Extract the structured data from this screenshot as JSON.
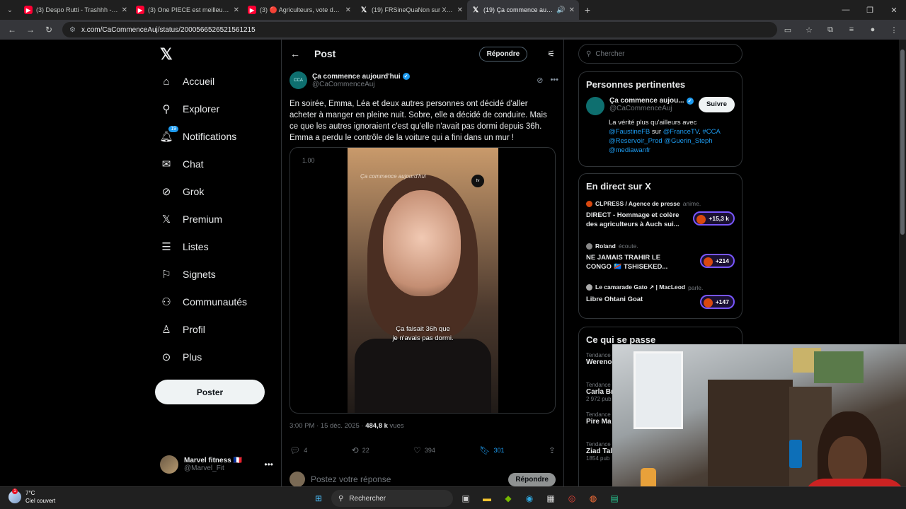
{
  "browser": {
    "tabs": [
      {
        "title": "(3) Despo Rutti - Trashhh - YouTube",
        "favicon": "youtube-icon"
      },
      {
        "title": "(3) One PIECE est meilleur sans",
        "favicon": "youtube-icon"
      },
      {
        "title": "(3) 🔴 Agriculteurs, vote du budget",
        "favicon": "youtube-icon"
      },
      {
        "title": "(19) FRSineQuaNon sur X : \"@T",
        "favicon": "x-icon"
      },
      {
        "title": "(19) Ça commence aujourd'",
        "favicon": "x-icon",
        "active": true
      }
    ],
    "url": "x.com/CaCommenceAuj/status/2000566526521561215"
  },
  "nav": {
    "items": [
      {
        "label": "Accueil",
        "icon": "home-icon"
      },
      {
        "label": "Explorer",
        "icon": "search-icon"
      },
      {
        "label": "Notifications",
        "icon": "bell-icon",
        "badge": "19"
      },
      {
        "label": "Chat",
        "icon": "mail-icon"
      },
      {
        "label": "Grok",
        "icon": "grok-icon"
      },
      {
        "label": "Premium",
        "icon": "x-logo-icon"
      },
      {
        "label": "Listes",
        "icon": "list-icon"
      },
      {
        "label": "Signets",
        "icon": "bookmark-icon"
      },
      {
        "label": "Communautés",
        "icon": "communities-icon"
      },
      {
        "label": "Profil",
        "icon": "person-icon"
      },
      {
        "label": "Plus",
        "icon": "more-circle-icon"
      }
    ],
    "post_button": "Poster",
    "account": {
      "name": "Marvel fitness 🇫🇷",
      "handle": "@Marvel_Fit"
    }
  },
  "main": {
    "header_title": "Post",
    "reply_chip": "Répondre",
    "tweet": {
      "author": "Ça commence aujourd'hui",
      "handle": "@CaCommenceAuj",
      "text": "En soirée, Emma, Léa et deux autres personnes ont décidé d'aller acheter à manger en pleine nuit. Sobre, elle a décidé de conduire. Mais ce que les autres ignoraient c'est qu'elle n'avait pas dormi depuis 36h. Emma a perdu le contrôle de la voiture qui a fini dans un mur !",
      "video_speed": "1.00",
      "video_watermark": "Ça commence aujourd'hui",
      "video_channel": "tv",
      "subtitle_line1": "Ça faisait 36h que",
      "subtitle_line2": "je n'avais pas dormi.",
      "time": "3:00 PM · 15 déc. 2025 · ",
      "views": "484,8 k",
      "views_label": " vues",
      "replies": "4",
      "reposts": "22",
      "likes": "394",
      "bookmarks": "301"
    },
    "reply_placeholder": "Postez votre réponse",
    "reply_button": "Répondre"
  },
  "right": {
    "search_placeholder": "Chercher",
    "relevant": {
      "title": "Personnes pertinentes",
      "name": "Ça commence aujou...",
      "handle": "@CaCommenceAuj",
      "follow": "Suivre",
      "bio_prefix": "La vérité plus qu'ailleurs avec ",
      "bio_link1": "@FaustineFB",
      "bio_mid": " sur ",
      "bio_link2": "@FranceTV",
      "bio_sep": ". ",
      "bio_link3": "#CCA",
      "bio_link4": "@Reservoir_Prod",
      "bio_link5": "@Guerin_Steph",
      "bio_link6": "@mediawanfr"
    },
    "live": {
      "title": "En direct sur X",
      "items": [
        {
          "host": "CLPRESS / Agence de presse",
          "status": "anime.",
          "title": "DIRECT - Hommage et colère des agriculteurs à Auch sui...",
          "count": "+15,3 k"
        },
        {
          "host": "Roland",
          "status": "écoute.",
          "title": "NE JAMAIS TRAHIR LE CONGO 🇨🇩 TSHISEKED...",
          "count": "+214"
        },
        {
          "host": "Le camarade Gato ↗ | MacLeod",
          "status": "parle.",
          "title": "Libre Ohtani Goat",
          "count": "+147"
        }
      ]
    },
    "trends": {
      "title": "Ce qui se passe",
      "items": [
        {
          "category": "Tendance",
          "name": "Wereno",
          "count": ""
        },
        {
          "category": "Tendance",
          "name": "Carla Br",
          "count": "2 972 pub"
        },
        {
          "category": "Tendance",
          "name": "Pire Ma",
          "count": ""
        },
        {
          "category": "Tendance",
          "name": "Ziad Tal",
          "count": "1854 pub"
        }
      ]
    }
  },
  "taskbar": {
    "temp": "7°C",
    "weather": "Ciel couvert",
    "search": "Rechercher"
  }
}
